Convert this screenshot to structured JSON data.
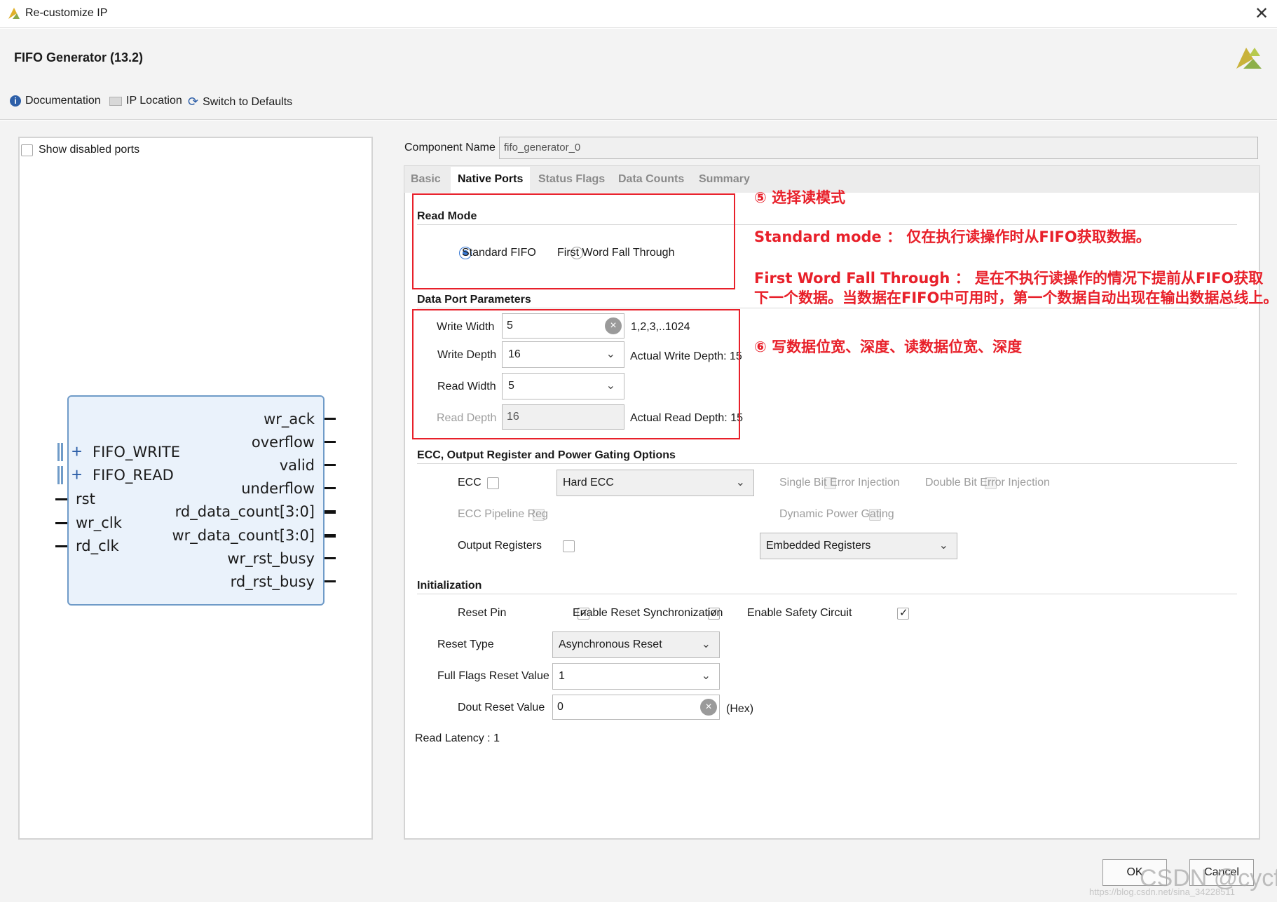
{
  "window": {
    "title": "Re-customize IP",
    "close_glyph": "✕"
  },
  "dialog": {
    "title": "FIFO Generator (13.2)"
  },
  "toolbar": {
    "documentation": "Documentation",
    "ip_location": "IP Location",
    "switch_defaults": "Switch to Defaults"
  },
  "left": {
    "show_disabled_ports": "Show disabled ports",
    "ports_right": [
      "wr_ack",
      "overflow",
      "valid",
      "underflow",
      "rd_data_count[3:0]",
      "wr_data_count[3:0]",
      "wr_rst_busy",
      "rd_rst_busy"
    ],
    "ports_bus": [
      "FIFO_WRITE",
      "FIFO_READ"
    ],
    "ports_left": [
      "rst",
      "wr_clk",
      "rd_clk"
    ]
  },
  "component": {
    "label": "Component Name",
    "value": "fifo_generator_0"
  },
  "tabs": [
    "Basic",
    "Native Ports",
    "Status Flags",
    "Data Counts",
    "Summary"
  ],
  "active_tab": "Native Ports",
  "read_mode": {
    "section": "Read Mode",
    "option1": "Standard FIFO",
    "option2": "First Word Fall Through",
    "selected": "Standard FIFO"
  },
  "data_port": {
    "section": "Data Port Parameters",
    "write_width_label": "Write Width",
    "write_width_value": "5",
    "write_width_range": "1,2,3,..1024",
    "write_depth_label": "Write Depth",
    "write_depth_value": "16",
    "actual_write_depth": "Actual Write Depth: 15",
    "read_width_label": "Read Width",
    "read_width_value": "5",
    "read_depth_label": "Read Depth",
    "read_depth_value": "16",
    "actual_read_depth": "Actual Read Depth: 15"
  },
  "ecc": {
    "section": "ECC, Output Register and Power Gating Options",
    "ecc_label": "ECC",
    "ecc_combo": "Hard ECC",
    "single_bit": "Single Bit Error Injection",
    "double_bit": "Double Bit Error Injection",
    "pipeline_reg": "ECC Pipeline Reg",
    "dynamic_power": "Dynamic Power Gating",
    "output_registers": "Output Registers",
    "output_reg_combo": "Embedded Registers"
  },
  "init": {
    "section": "Initialization",
    "reset_pin": "Reset Pin",
    "enable_reset_sync": "Enable Reset Synchronization",
    "enable_safety": "Enable Safety Circuit",
    "reset_type_label": "Reset Type",
    "reset_type_value": "Asynchronous Reset",
    "full_flags_label": "Full Flags Reset Value",
    "full_flags_value": "1",
    "dout_reset_label": "Dout Reset Value",
    "dout_reset_value": "0",
    "hex_suffix": "(Hex)",
    "read_latency": "Read Latency : 1"
  },
  "annotations": {
    "step5": "⑤ 选择读模式",
    "standard": "Standard mode ： 仅在执行读操作时从FIFO获取数据。",
    "fwft_line1": "First Word Fall Through ： 是在不执行读操作的情况下提前从FIFO获取",
    "fwft_line2": "下一个数据。当数据在FIFO中可用时，第一个数据自动出现在输出数据总线上。",
    "step6": "⑥ 写数据位宽、深度、读数据位宽、深度"
  },
  "buttons": {
    "ok": "OK",
    "cancel": "Cancel"
  },
  "watermark": {
    "main": "CSDN @cycf",
    "url": "https://blog.csdn.net/sina_34228511"
  },
  "colors": {
    "annotation_red": "#e8202a",
    "block_fill": "#eaf2fb",
    "block_border": "#6f9bc8",
    "radio_blue": "#3a7bd5"
  }
}
